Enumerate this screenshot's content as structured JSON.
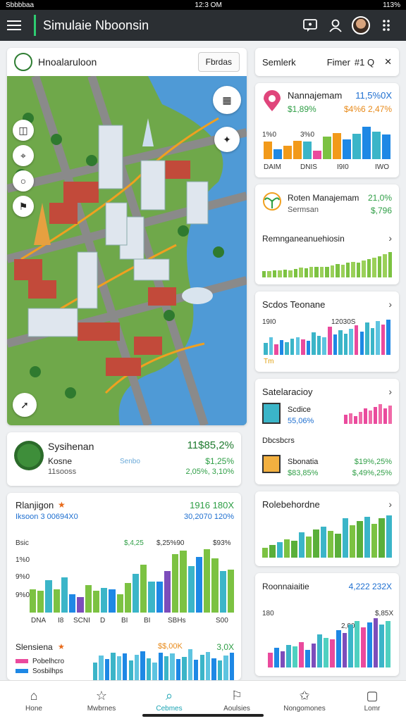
{
  "status": {
    "left": "Sbbbbaa",
    "center": "12:3 OM",
    "right": "113%"
  },
  "appbar": {
    "title": "Simulaie Nboonsin",
    "icons": [
      "menu-icon",
      "chat-icon",
      "user-icon",
      "avatar",
      "more-vert-icon"
    ]
  },
  "map": {
    "title": "Hnoalaruloon",
    "button": "Fbrdas"
  },
  "search_panel": {
    "placeholder": "Semlerk",
    "filter": "Fimer",
    "filter_icon": "#1 Q"
  },
  "panel1": {
    "title": "Nannajemam",
    "v1": "11,5%0X",
    "v2": "$1,89%",
    "v3": "$4%6",
    "v4": "2,47%",
    "chart": {
      "ticks_y": [
        "1%0",
        "3%0"
      ],
      "x": [
        "DAIM",
        "DNIS",
        "I9I0",
        "IWO"
      ],
      "values": [
        40,
        22,
        30,
        42,
        40,
        20,
        52,
        60,
        45,
        58,
        74,
        62,
        56
      ]
    }
  },
  "panel2": {
    "title": "Roten Manajemam",
    "v1": "21,0%",
    "sub": "Sermsan",
    "v2": "$,796",
    "sub2": "Remnganeanuehiosin",
    "chart": {
      "values": [
        10,
        11,
        12,
        12,
        13,
        12,
        14,
        16,
        15,
        17,
        18,
        17,
        18,
        20,
        22,
        21,
        24,
        26,
        25,
        28,
        30,
        33,
        35,
        38,
        42
      ]
    }
  },
  "panel3": {
    "title": "Scdos Teonane",
    "tick_left": "19I0",
    "tick_mid": "12030S",
    "footer": "Tm",
    "chart": {
      "values": [
        20,
        30,
        18,
        25,
        22,
        28,
        30,
        26,
        24,
        38,
        32,
        30,
        48,
        35,
        42,
        36,
        44,
        50,
        40,
        55,
        46,
        58,
        52,
        60
      ]
    }
  },
  "panel4": {
    "title": "Satelaracioy",
    "row1_label": "Scdice",
    "row1_value": "55,06%",
    "row2_label": "Dbcsbcrs",
    "row3_label": "Sbonatia",
    "row3_v1": "$19%,25%",
    "row3_v2": "$83,85%",
    "row3_v3": "$,49%,25%",
    "chart": {
      "values": [
        12,
        14,
        10,
        16,
        20,
        18,
        22,
        26,
        20,
        24
      ]
    }
  },
  "panel5": {
    "title": "Rolebehordne",
    "chart": {
      "values": [
        14,
        18,
        22,
        26,
        24,
        36,
        30,
        40,
        44,
        38,
        34,
        56,
        46,
        52,
        58,
        48,
        56,
        60
      ]
    }
  },
  "panel6": {
    "title": "Roonnaiaitie",
    "v1": "4,222 232X",
    "tick1": "180",
    "tick2": "$,85X",
    "tick3": "2,00",
    "chart": {
      "values": [
        20,
        26,
        22,
        30,
        28,
        34,
        24,
        32,
        44,
        40,
        38,
        50,
        46,
        58,
        62,
        54,
        60,
        66,
        58,
        62
      ]
    }
  },
  "summary": {
    "title": "Sysihenan",
    "v1": "11$85,2%",
    "sub": "Kosne",
    "sub_value": "$1,25%",
    "sub_extra": "Senbo",
    "meta": "11sooss",
    "meta_value": "2,05%, 3,10%"
  },
  "big_chart": {
    "title": "Rlanjigon",
    "value": "1916 180X",
    "subtitle": "Iksoon 3 00694X0",
    "subvalue": "30,2070 120%",
    "ylabels": [
      "Bsic",
      "1%0",
      "9%0",
      "9%0"
    ],
    "x": [
      "DNA",
      "I8",
      "SCNI",
      "D",
      "BI",
      "BI",
      "SBHs",
      "S00"
    ],
    "notes": [
      "$,4,25",
      "$,25%90",
      "$93%"
    ],
    "values": [
      30,
      28,
      42,
      30,
      46,
      24,
      20,
      36,
      28,
      32,
      30,
      24,
      38,
      50,
      62,
      40,
      40,
      54,
      76,
      80,
      60,
      72,
      82,
      70,
      54,
      56
    ]
  },
  "sub_chart": {
    "title": "Slensiena",
    "v1": "$$,00K",
    "v2": "3,0X",
    "legend1": "Pobelhcro",
    "legend2": "Sosbilhps",
    "values": [
      40,
      56,
      48,
      62,
      54,
      60,
      44,
      58,
      66,
      50,
      40,
      62,
      54,
      60,
      48,
      52,
      70,
      46,
      58,
      64,
      50,
      44,
      56,
      62
    ]
  },
  "nav": [
    {
      "label": "Hone",
      "icon": "home-icon"
    },
    {
      "label": "Mwbrnes",
      "icon": "star-icon"
    },
    {
      "label": "Cebmes",
      "icon": "search-icon"
    },
    {
      "label": "Aoulsies",
      "icon": "map-icon"
    },
    {
      "label": "Nongomones",
      "icon": "star-outline-icon"
    },
    {
      "label": "Lomr",
      "icon": "box-icon"
    }
  ],
  "colors": {
    "accent": "#2ecc71",
    "blue": "#1e88e5",
    "teal": "#3bb5c8",
    "green": "#7cc242",
    "orange": "#f29a1a",
    "pink": "#ea4a9d",
    "purple": "#7c4dbb"
  }
}
